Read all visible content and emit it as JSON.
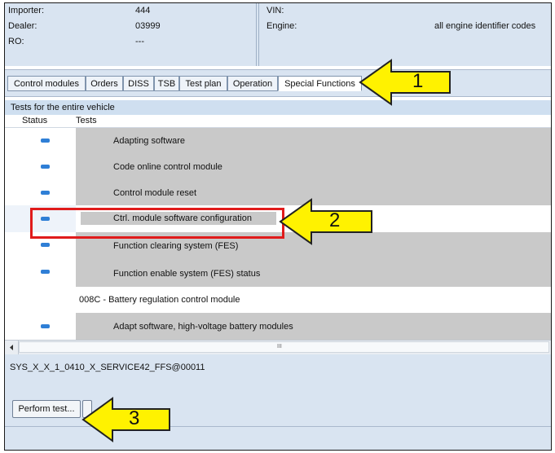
{
  "header": {
    "importer_label": "Importer:",
    "importer_value": "444",
    "dealer_label": "Dealer:",
    "dealer_value": "03999",
    "ro_label": "RO:",
    "ro_value": "---",
    "vin_label": "VIN:",
    "engine_label": "Engine:",
    "engine_value": "all engine identifier codes"
  },
  "tabs": [
    {
      "label": "Control modules"
    },
    {
      "label": "Orders"
    },
    {
      "label": "DISS"
    },
    {
      "label": "TSB"
    },
    {
      "label": "Test plan"
    },
    {
      "label": "Operation"
    },
    {
      "label": "Special Functions",
      "active": true
    }
  ],
  "tests_panel": {
    "title": "Tests for the entire vehicle",
    "col_status": "Status",
    "col_tests": "Tests",
    "rows": [
      {
        "label": "Adapting software"
      },
      {
        "label": "Code online control module"
      },
      {
        "label": "Control module reset"
      },
      {
        "label": "Ctrl. module software configuration",
        "selected": true
      },
      {
        "label": "Function clearing system (FES)"
      },
      {
        "label": "Function enable system (FES) status"
      },
      {
        "label": "008C - Battery regulation control module",
        "group": true
      },
      {
        "label": "Adapt software, high-voltage battery modules"
      }
    ]
  },
  "scrollbar": {
    "thumb_grip": "III"
  },
  "status_text": "SYS_X_X_1_0410_X_SERVICE42_FFS@00011",
  "buttons": {
    "perform_test": "Perform test..."
  },
  "callouts": [
    {
      "number": "1"
    },
    {
      "number": "2"
    },
    {
      "number": "3"
    }
  ],
  "colors": {
    "panel_bg": "#d9e4f1",
    "row_gray": "#c9c9c9",
    "status_mark": "#2f7fd6",
    "highlight_box": "#e01b1b",
    "callout_arrow": "#fff200"
  }
}
